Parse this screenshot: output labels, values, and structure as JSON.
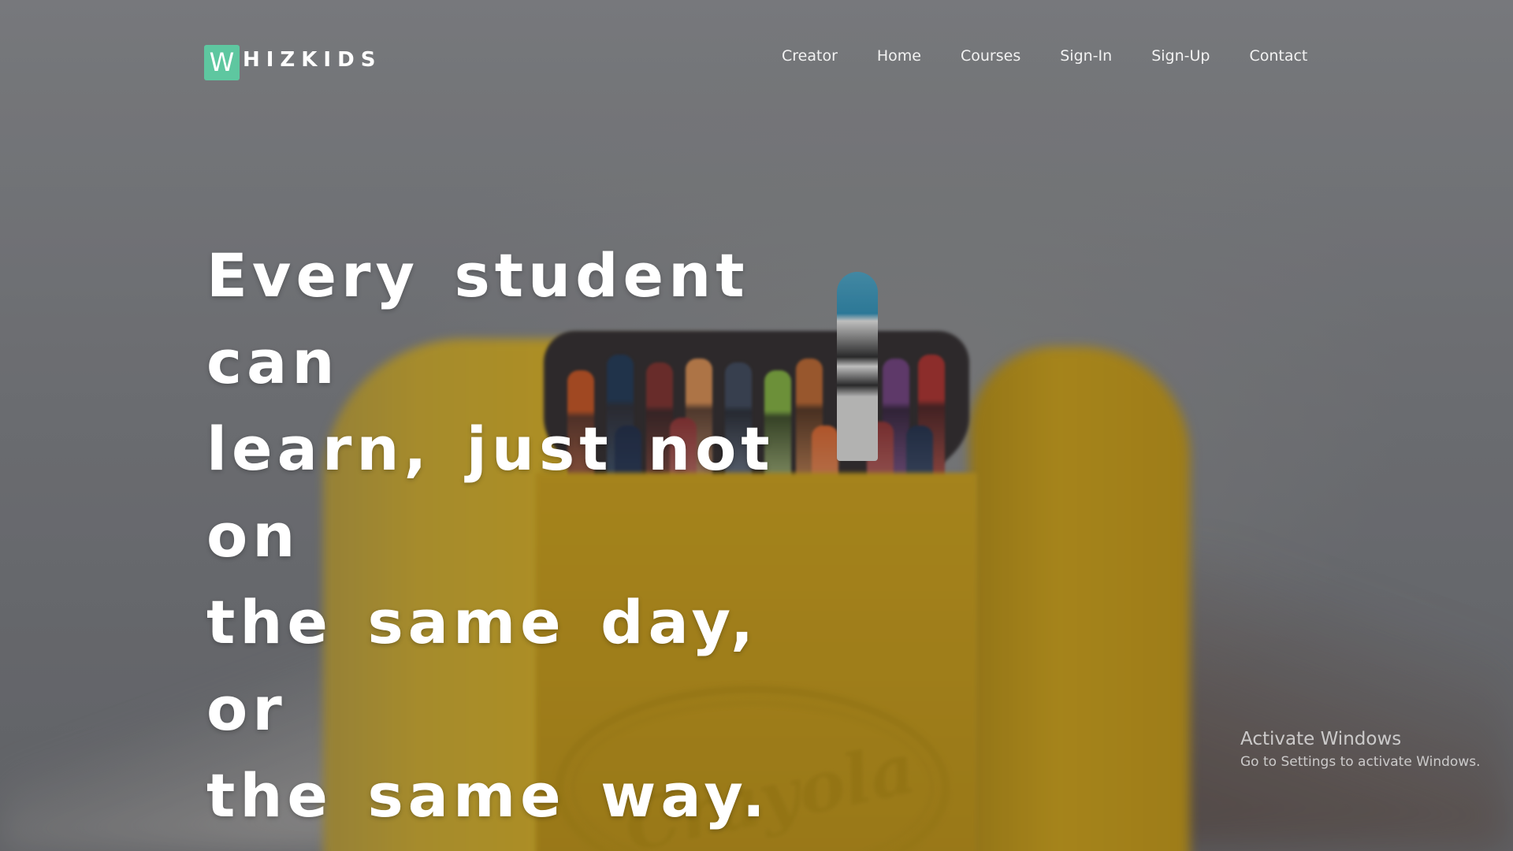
{
  "brand": {
    "mark_letter": "W",
    "rest_text": "HIZKIDS",
    "mark_color": "#5ec7a0"
  },
  "nav": {
    "items": [
      {
        "label": "Creator"
      },
      {
        "label": "Home"
      },
      {
        "label": "Courses"
      },
      {
        "label": "Sign-In"
      },
      {
        "label": "Sign-Up"
      },
      {
        "label": "Contact"
      }
    ]
  },
  "hero": {
    "lines": [
      "Every student can",
      "learn, just not on",
      "the same day, or",
      "the same way."
    ]
  },
  "background": {
    "logo_word": "Crayola"
  },
  "watermark": {
    "title": "Activate Windows",
    "subtitle": "Go to Settings to activate Windows."
  }
}
